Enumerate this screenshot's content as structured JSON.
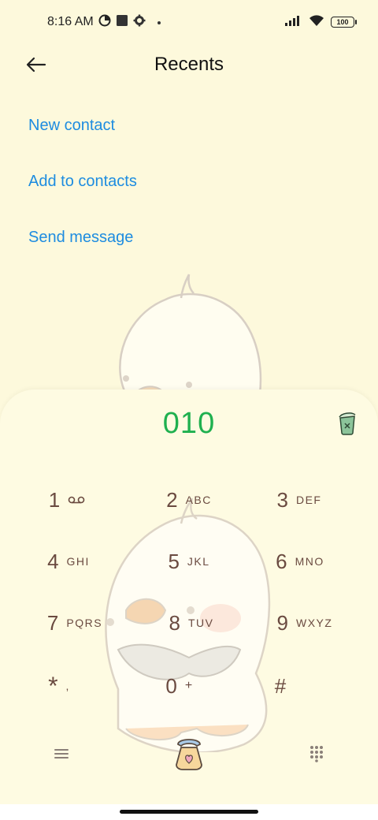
{
  "status_bar": {
    "time": "8:16 AM",
    "battery": "100",
    "icons": [
      "data-saver-icon",
      "square-icon",
      "settings-icon",
      "dot-icon",
      "signal-icon",
      "wifi-icon",
      "battery-icon"
    ]
  },
  "header": {
    "title": "Recents",
    "back_icon": "back-arrow-icon"
  },
  "actions": {
    "new_contact": "New contact",
    "add_to_contacts": "Add to contacts",
    "send_message": "Send message"
  },
  "dialer": {
    "number": "010",
    "clear_icon": "trash-clear-icon",
    "keys": [
      {
        "digit": "1",
        "letters": ""
      },
      {
        "digit": "2",
        "letters": "ABC"
      },
      {
        "digit": "3",
        "letters": "DEF"
      },
      {
        "digit": "4",
        "letters": "GHI"
      },
      {
        "digit": "5",
        "letters": "JKL"
      },
      {
        "digit": "6",
        "letters": "MNO"
      },
      {
        "digit": "7",
        "letters": "PQRS"
      },
      {
        "digit": "8",
        "letters": "TUV"
      },
      {
        "digit": "9",
        "letters": "WXYZ"
      },
      {
        "digit": "*",
        "letters": ","
      },
      {
        "digit": "0",
        "letters": "+"
      },
      {
        "digit": "#",
        "letters": ""
      }
    ],
    "menu_icon": "menu-icon",
    "call_icon": "call-phone-icon",
    "keypad_icon": "keypad-icon"
  },
  "colors": {
    "background": "#fdf9dc",
    "link": "#1d8ce0",
    "number": "#1fb04f",
    "key_text": "#6a4a40"
  }
}
